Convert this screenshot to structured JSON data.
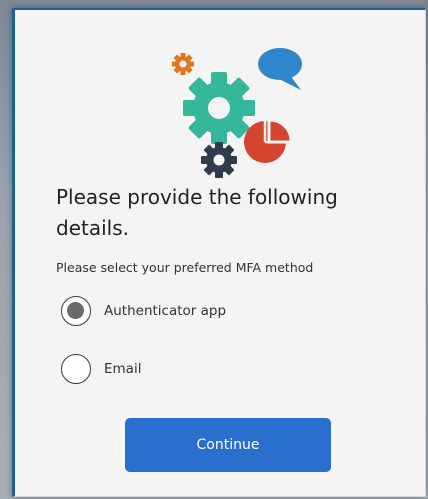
{
  "colors": {
    "accent": "#2a6fce",
    "gear_teal": "#35b79b",
    "gear_orange": "#e0761f",
    "gear_dark": "#2f3b48",
    "chat_blue": "#2f86cd",
    "pie_red": "#d3452f"
  },
  "illustration": {
    "icons": [
      "gear-icon",
      "chat-bubble-icon",
      "pie-chart-icon"
    ]
  },
  "form": {
    "heading": "Please provide the following details.",
    "prompt": "Please select your preferred MFA method",
    "options": [
      {
        "label": "Authenticator app",
        "selected": true
      },
      {
        "label": "Email",
        "selected": false
      }
    ],
    "continue_label": "Continue"
  }
}
